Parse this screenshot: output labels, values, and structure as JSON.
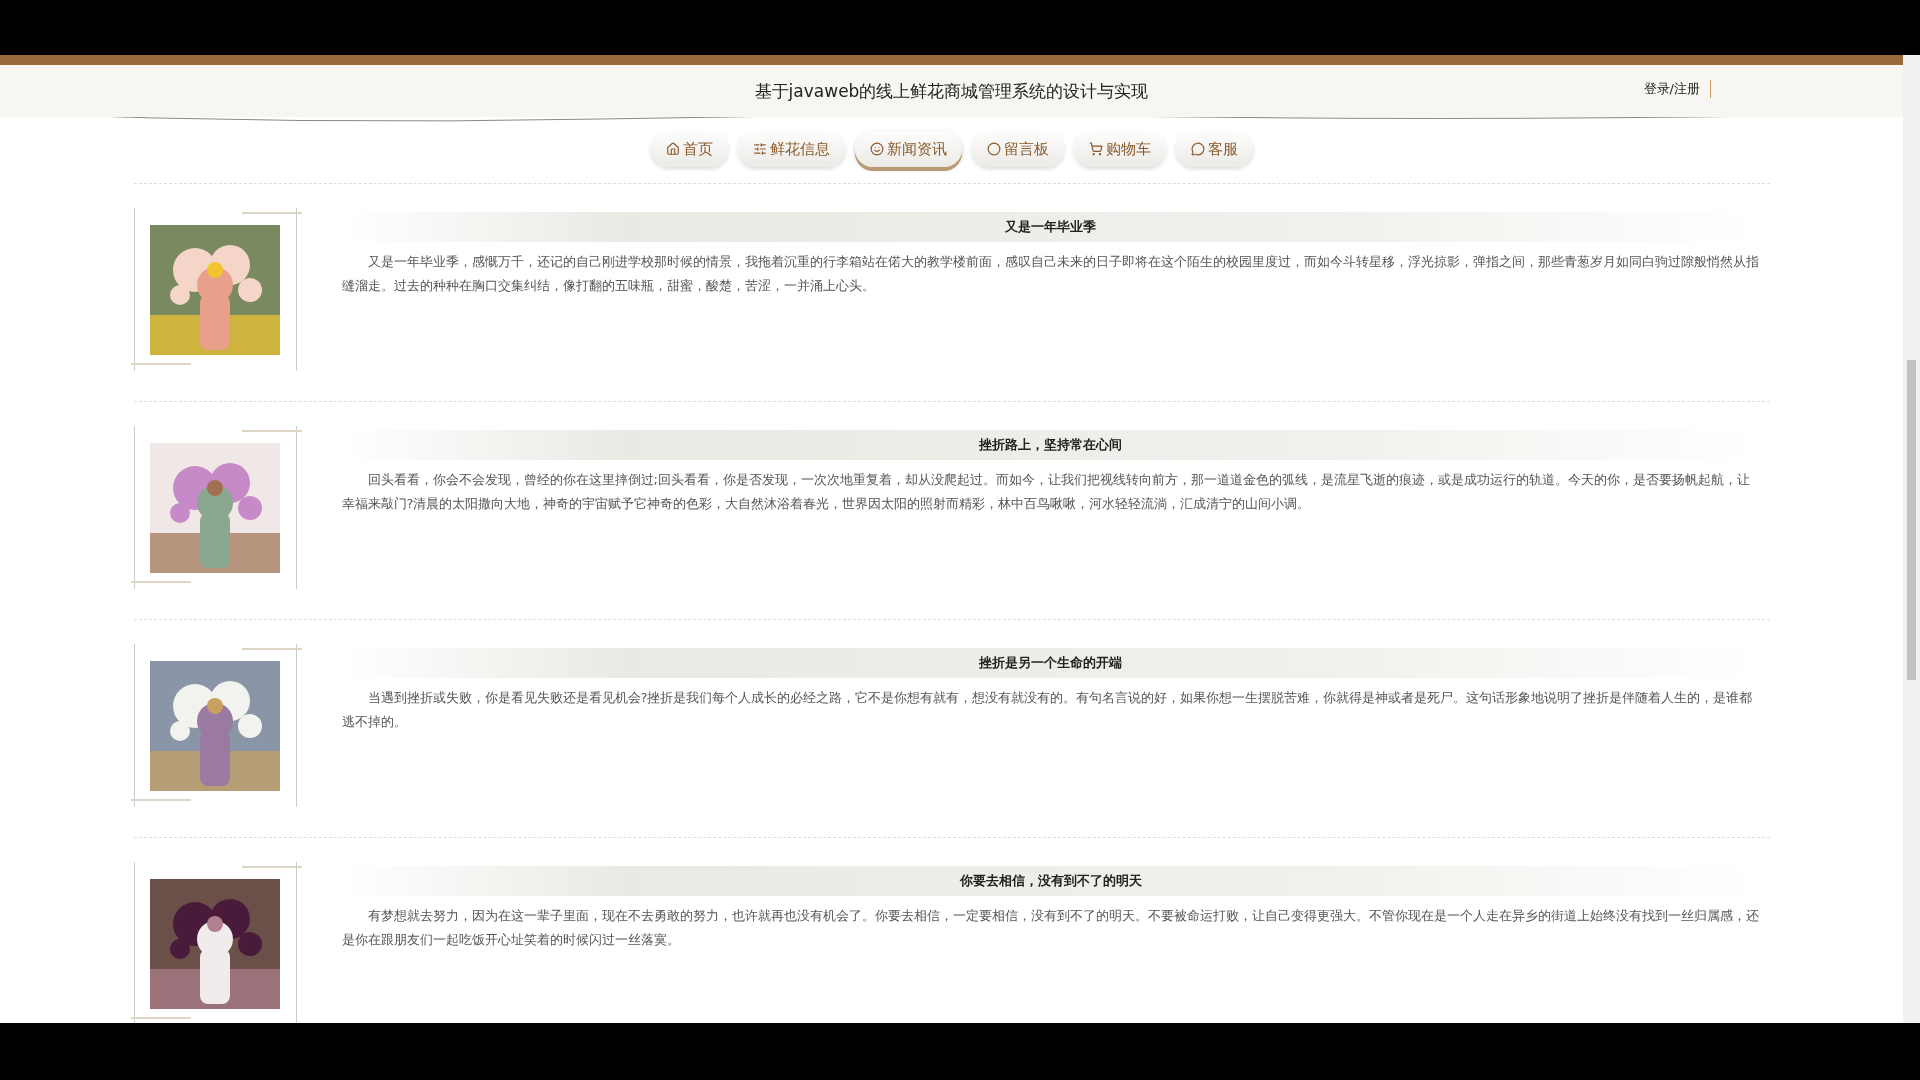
{
  "header": {
    "title": "基于javaweb的线上鲜花商城管理系统的设计与实现",
    "login": "登录/注册"
  },
  "nav": [
    {
      "label": "首页",
      "kind": "home",
      "selected": false
    },
    {
      "label": "鲜花信息",
      "kind": "sliders",
      "selected": false
    },
    {
      "label": "新闻资讯",
      "kind": "smile",
      "selected": true
    },
    {
      "label": "留言板",
      "kind": "circle",
      "selected": false
    },
    {
      "label": "购物车",
      "kind": "cart",
      "selected": false
    },
    {
      "label": "客服",
      "kind": "chat",
      "selected": false
    }
  ],
  "articles": [
    {
      "title": "又是一年毕业季",
      "body": "又是一年毕业季，感慨万千，还记的自己刚进学校那时候的情景，我拖着沉重的行李箱站在偌大的教学楼前面，感叹自己未来的日子即将在这个陌生的校园里度过，而如今斗转星移，浮光掠影，弹指之间，那些青葱岁月如同白驹过隙般悄然从指缝溜走。过去的种种在胸口交集纠结，像打翻的五味瓶，甜蜜，酸楚，苦涩，一并涌上心头。"
    },
    {
      "title": "挫折路上，坚持常在心间",
      "body": "回头看看，你会不会发现，曾经的你在这里摔倒过;回头看看，你是否发现，一次次地重复着，却从没爬起过。而如今，让我们把视线转向前方，那一道道金色的弧线，是流星飞逝的痕迹，或是成功运行的轨道。今天的你，是否要扬帆起航，让幸福来敲门?清晨的太阳撒向大地，神奇的宇宙赋予它神奇的色彩，大自然沐浴着春光，世界因太阳的照射而精彩，林中百鸟啾啾，河水轻轻流淌，汇成清宁的山间小调。"
    },
    {
      "title": "挫折是另一个生命的开端",
      "body": "当遇到挫折或失败，你是看见失败还是看见机会?挫折是我们每个人成长的必经之路，它不是你想有就有，想没有就没有的。有句名言说的好，如果你想一生摆脱苦难，你就得是神或者是死尸。这句话形象地说明了挫折是伴随着人生的，是谁都逃不掉的。"
    },
    {
      "title": "你要去相信，没有到不了的明天",
      "body": "有梦想就去努力，因为在这一辈子里面，现在不去勇敢的努力，也许就再也没有机会了。你要去相信，一定要相信，没有到不了的明天。不要被命运打败，让自己变得更强大。不管你现在是一个人走在异乡的街道上始终没有找到一丝归属感，还是你在跟朋友们一起吃饭开心址笑着的时候闪过一丝落寞。"
    }
  ]
}
